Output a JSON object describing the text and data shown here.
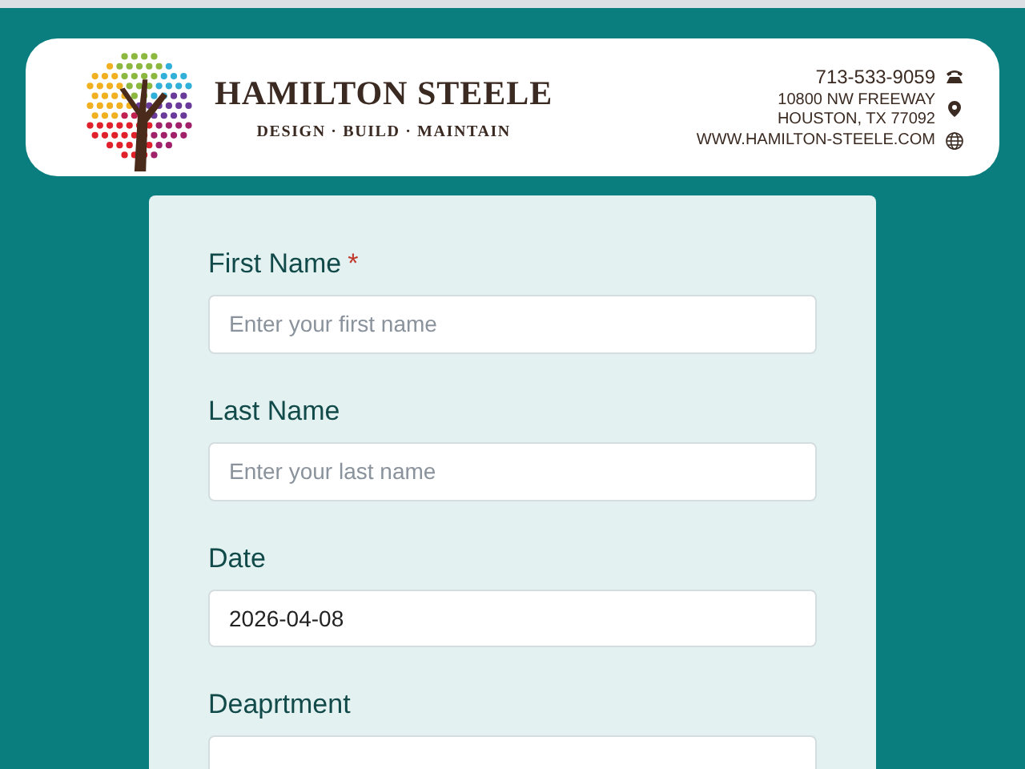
{
  "header": {
    "company": "HAMILTON STEELE",
    "tagline": "DESIGN · BUILD · MAINTAIN",
    "phone": "713-533-9059",
    "address_lines": [
      "10800 NW FREEWAY",
      "HOUSTON, TX 77092"
    ],
    "website": "WWW.HAMILTON-STEELE.COM"
  },
  "form": {
    "fields": [
      {
        "label": "First Name",
        "required_mark": "*",
        "placeholder": "Enter your first name"
      },
      {
        "label": "Last Name",
        "placeholder": "Enter your last name"
      },
      {
        "label": "Date",
        "value": "2026-04-08"
      },
      {
        "label": "Deaprtment"
      }
    ]
  }
}
